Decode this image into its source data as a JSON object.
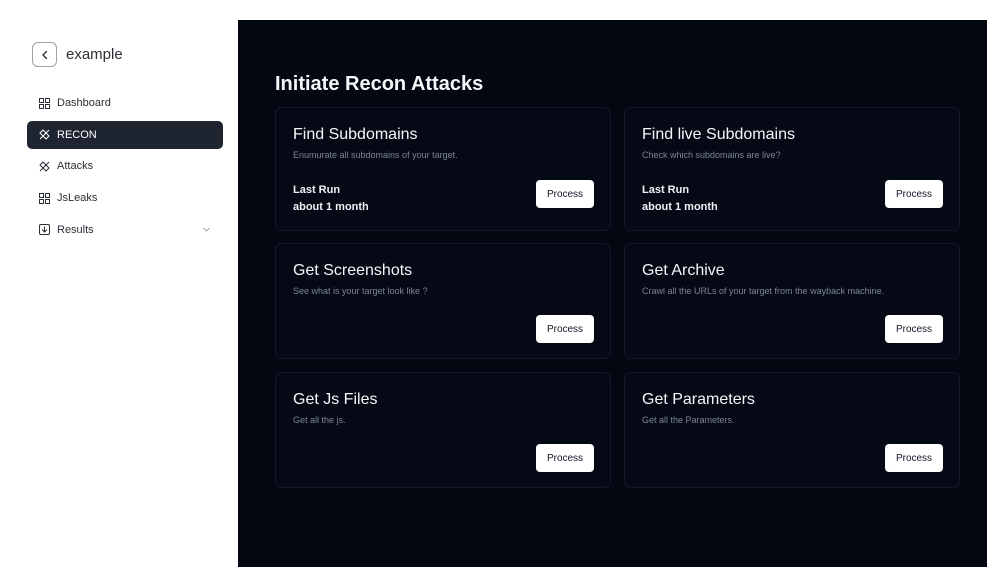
{
  "sidebar": {
    "project_name": "example",
    "items": [
      {
        "label": "Dashboard",
        "icon": "grid-icon"
      },
      {
        "label": "RECON",
        "icon": "crosshair-icon",
        "active": true
      },
      {
        "label": "Attacks",
        "icon": "crosshair-icon"
      },
      {
        "label": "JsLeaks",
        "icon": "grid-icon"
      },
      {
        "label": "Results",
        "icon": "box-icon",
        "expandable": true
      }
    ]
  },
  "main": {
    "title": "Initiate Recon Attacks",
    "cards": [
      {
        "title": "Find Subdomains",
        "description": "Enumurate all subdomains of your target.",
        "last_run_label": "Last Run",
        "last_run_value": "about 1 month",
        "button": "Process"
      },
      {
        "title": "Find live Subdomains",
        "description": "Check which subdomains are live?",
        "last_run_label": "Last Run",
        "last_run_value": "about 1 month",
        "button": "Process"
      },
      {
        "title": "Get Screenshots",
        "description": "See what is your target look like ?",
        "button": "Process"
      },
      {
        "title": "Get Archive",
        "description": "Crawl all the URLs of your target from the wayback machine.",
        "button": "Process"
      },
      {
        "title": "Get Js Files",
        "description": "Get all the js.",
        "button": "Process"
      },
      {
        "title": "Get Parameters",
        "description": "Get all the Parameters.",
        "button": "Process"
      }
    ]
  },
  "colors": {
    "main_bg": "#030712",
    "active_nav_bg": "#1f2530",
    "button_bg": "#ffffff"
  }
}
